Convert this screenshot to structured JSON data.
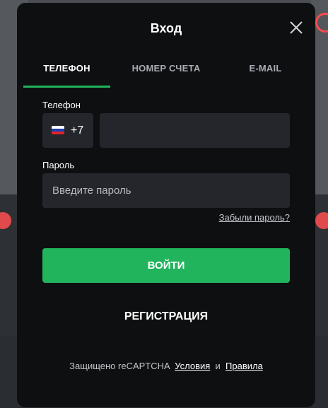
{
  "modal": {
    "title": "Вход"
  },
  "tabs": [
    {
      "label": "ТЕЛЕФОН",
      "active": true
    },
    {
      "label": "НОМЕР СЧЕТА",
      "active": false
    },
    {
      "label": "E-MAIL",
      "active": false
    }
  ],
  "phone": {
    "label": "Телефон",
    "country_code": "+7",
    "flag": "russia-flag-icon",
    "value": ""
  },
  "password": {
    "label": "Пароль",
    "placeholder": "Введите пароль"
  },
  "forgot_password": "Забыли пароль?",
  "login_button": "ВОЙТИ",
  "register_button": "РЕГИСТРАЦИЯ",
  "footer": {
    "protected_text": "Защищено reCAPTCHA",
    "terms_link": "Условия",
    "and_text": "и",
    "privacy_link": "Правила"
  },
  "colors": {
    "modal_bg": "#0e0f11",
    "input_bg": "#24262b",
    "accent": "#22b35d",
    "text": "#ffffff",
    "muted": "#a9adb3"
  }
}
